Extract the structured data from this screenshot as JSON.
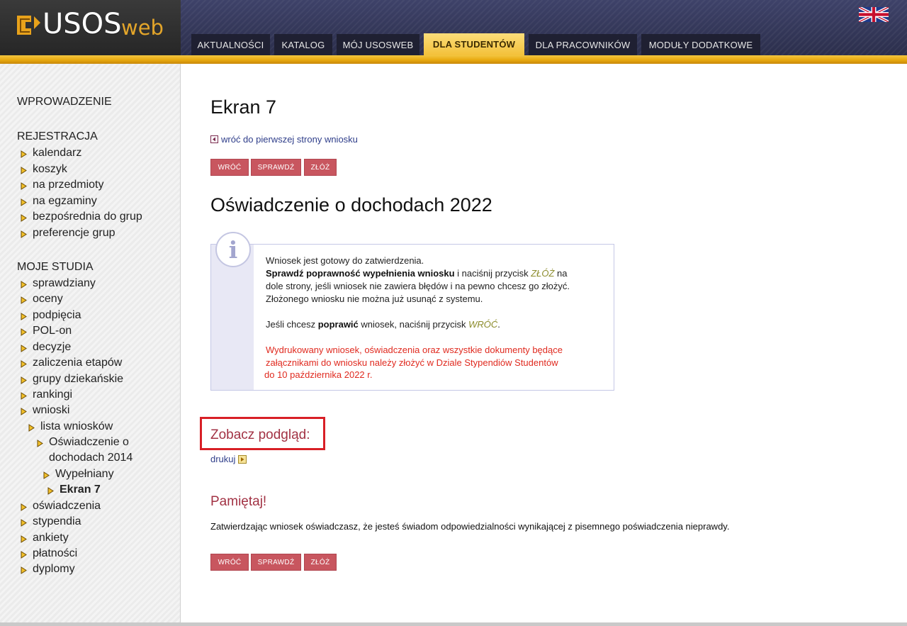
{
  "header": {
    "logo_main": "USOS",
    "logo_sub": "web",
    "tabs": [
      {
        "label": "AKTUALNOŚCI",
        "active": false
      },
      {
        "label": "KATALOG",
        "active": false
      },
      {
        "label": "MÓJ USOSWEB",
        "active": false
      },
      {
        "label": "DLA STUDENTÓW",
        "active": true
      },
      {
        "label": "DLA PRACOWNIKÓW",
        "active": false
      },
      {
        "label": "MODUŁY DODATKOWE",
        "active": false
      }
    ],
    "language_icon": "uk-flag-icon"
  },
  "sidebar": {
    "intro": "WPROWADZENIE",
    "registration": {
      "title": "REJESTRACJA",
      "items": [
        "kalendarz",
        "koszyk",
        "na przedmioty",
        "na egzaminy",
        "bezpośrednia do grup",
        "preferencje grup"
      ]
    },
    "studies": {
      "title": "MOJE STUDIA",
      "items": [
        "sprawdziany",
        "oceny",
        "podpięcia",
        "POL-on",
        "decyzje",
        "zaliczenia etapów",
        "grupy dziekańskie",
        "rankingi",
        "wnioski"
      ],
      "sub": {
        "list": "lista wniosków",
        "doc_line1": "Oświadczenie o",
        "doc_line2": "dochodach 2014",
        "filled": "Wypełniany",
        "current": "Ekran 7"
      },
      "items_after": [
        "oświadczenia",
        "stypendia",
        "ankiety",
        "płatności",
        "dyplomy"
      ]
    },
    "bullet_icon": "yellow-arrow-bullet-icon"
  },
  "main": {
    "screen_title": "Ekran 7",
    "back_link": "wróć do pierwszej strony wniosku",
    "buttons": {
      "back": "WRÓĆ",
      "check": "SPRAWDŹ",
      "submit": "ZŁÓŻ"
    },
    "form_title": "Oświadczenie o dochodach 2022",
    "info": {
      "icon": "info-icon",
      "line1": "Wniosek jest gotowy do zatwierdzenia.",
      "line2_bold": "Sprawdź poprawność wypełnienia wniosku",
      "line2_rest": " i naciśnij przycisk ",
      "line2_button": "ZŁÓŻ",
      "line2_end": " na",
      "line3": "dole strony, jeśli wniosek nie zawiera błędów i na pewno chcesz go złożyć.",
      "line4": "Złożonego wniosku nie można już usunąć z systemu.",
      "line5_start": "Jeśli chcesz ",
      "line5_bold": "poprawić",
      "line5_mid": " wniosek, naciśnij przycisk ",
      "line5_button": "WRÓĆ",
      "line5_end": ".",
      "red_line1": "Wydrukowany wniosek, oświadczenia oraz wszystkie dokumenty będące",
      "red_line2": "załącznikami do wniosku należy złożyć w Dziale Stypendiów Studentów",
      "red_line3": "do 10 października 2022 r."
    },
    "preview_heading": "Zobacz podgląd:",
    "print_link": "drukuj",
    "remember_heading": "Pamiętaj!",
    "remember_text": "Zatwierdzając wniosek oświadczasz, że jesteś świadom odpowiedzialności wynikającej z pisemnego poświadczenia nieprawdy."
  }
}
